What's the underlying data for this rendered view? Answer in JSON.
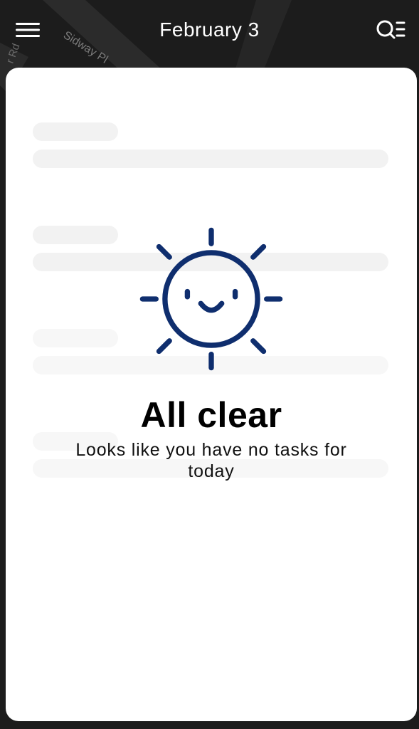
{
  "header": {
    "title": "February 3",
    "menu_icon": "hamburger-menu-icon",
    "search_icon": "search-list-icon"
  },
  "map": {
    "street_label_1": "Sidway Pl",
    "street_label_2": "r Rd"
  },
  "empty_state": {
    "icon": "smiling-sun-icon",
    "title": "All clear",
    "subtitle": "Looks like you have no tasks for today"
  },
  "colors": {
    "accent": "#0f2e6e",
    "sheet_bg": "#ffffff",
    "header_text": "#ffffff",
    "skeleton": "#f2f2f2"
  }
}
